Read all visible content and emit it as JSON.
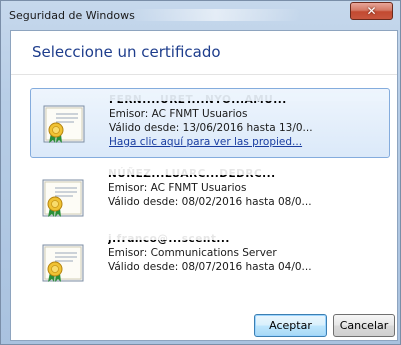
{
  "window": {
    "title": "Seguridad de Windows",
    "close_glyph": "✕"
  },
  "dialog": {
    "heading": "Seleccione un certificado"
  },
  "certificates": [
    {
      "name": "FERN....URET...NYO...AMU...",
      "issuer": "Emisor: AC FNMT Usuarios",
      "validity": "Válido desde: 13/06/2016 hasta 13/0...",
      "link": "Haga clic aquí para ver las propied...",
      "selected": true
    },
    {
      "name": "NÚÑEZ...LUARC...DEDRC...",
      "issuer": "Emisor: AC FNMT Usuarios",
      "validity": "Válido desde: 08/02/2016 hasta 08/0...",
      "selected": false
    },
    {
      "name": "j.franco@...scent...",
      "issuer": "Emisor: Communications Server",
      "validity": "Válido desde: 08/07/2016 hasta 04/0...",
      "selected": false
    }
  ],
  "buttons": {
    "accept": "Aceptar",
    "cancel": "Cancelar"
  },
  "icons": {
    "certificate": "certificate-icon",
    "close": "close-icon"
  },
  "colors": {
    "heading": "#1e3d8c",
    "selection_border": "#84acdd",
    "close_button": "#c24a31"
  }
}
